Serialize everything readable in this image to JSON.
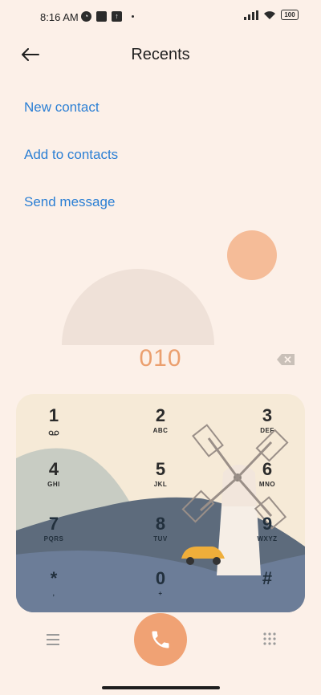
{
  "status_bar": {
    "time": "8:16 AM",
    "battery": "100"
  },
  "header": {
    "title": "Recents"
  },
  "actions": [
    {
      "label": "New contact"
    },
    {
      "label": "Add to contacts"
    },
    {
      "label": "Send message"
    }
  ],
  "dialer": {
    "number": "010"
  },
  "keypad": [
    {
      "digit": "1",
      "letters": "voicemail-icon"
    },
    {
      "digit": "2",
      "letters": "ABC"
    },
    {
      "digit": "3",
      "letters": "DEF"
    },
    {
      "digit": "4",
      "letters": "GHI"
    },
    {
      "digit": "5",
      "letters": "JKL"
    },
    {
      "digit": "6",
      "letters": "MNO"
    },
    {
      "digit": "7",
      "letters": "PQRS"
    },
    {
      "digit": "8",
      "letters": "TUV"
    },
    {
      "digit": "9",
      "letters": "WXYZ"
    },
    {
      "digit": "*",
      "letters": ","
    },
    {
      "digit": "0",
      "letters": "+"
    },
    {
      "digit": "#",
      "letters": ""
    }
  ],
  "colors": {
    "background": "#fcf0e8",
    "accent_link": "#2b7fd4",
    "call_button": "#f0a274",
    "number_text": "#eb9f6e"
  }
}
